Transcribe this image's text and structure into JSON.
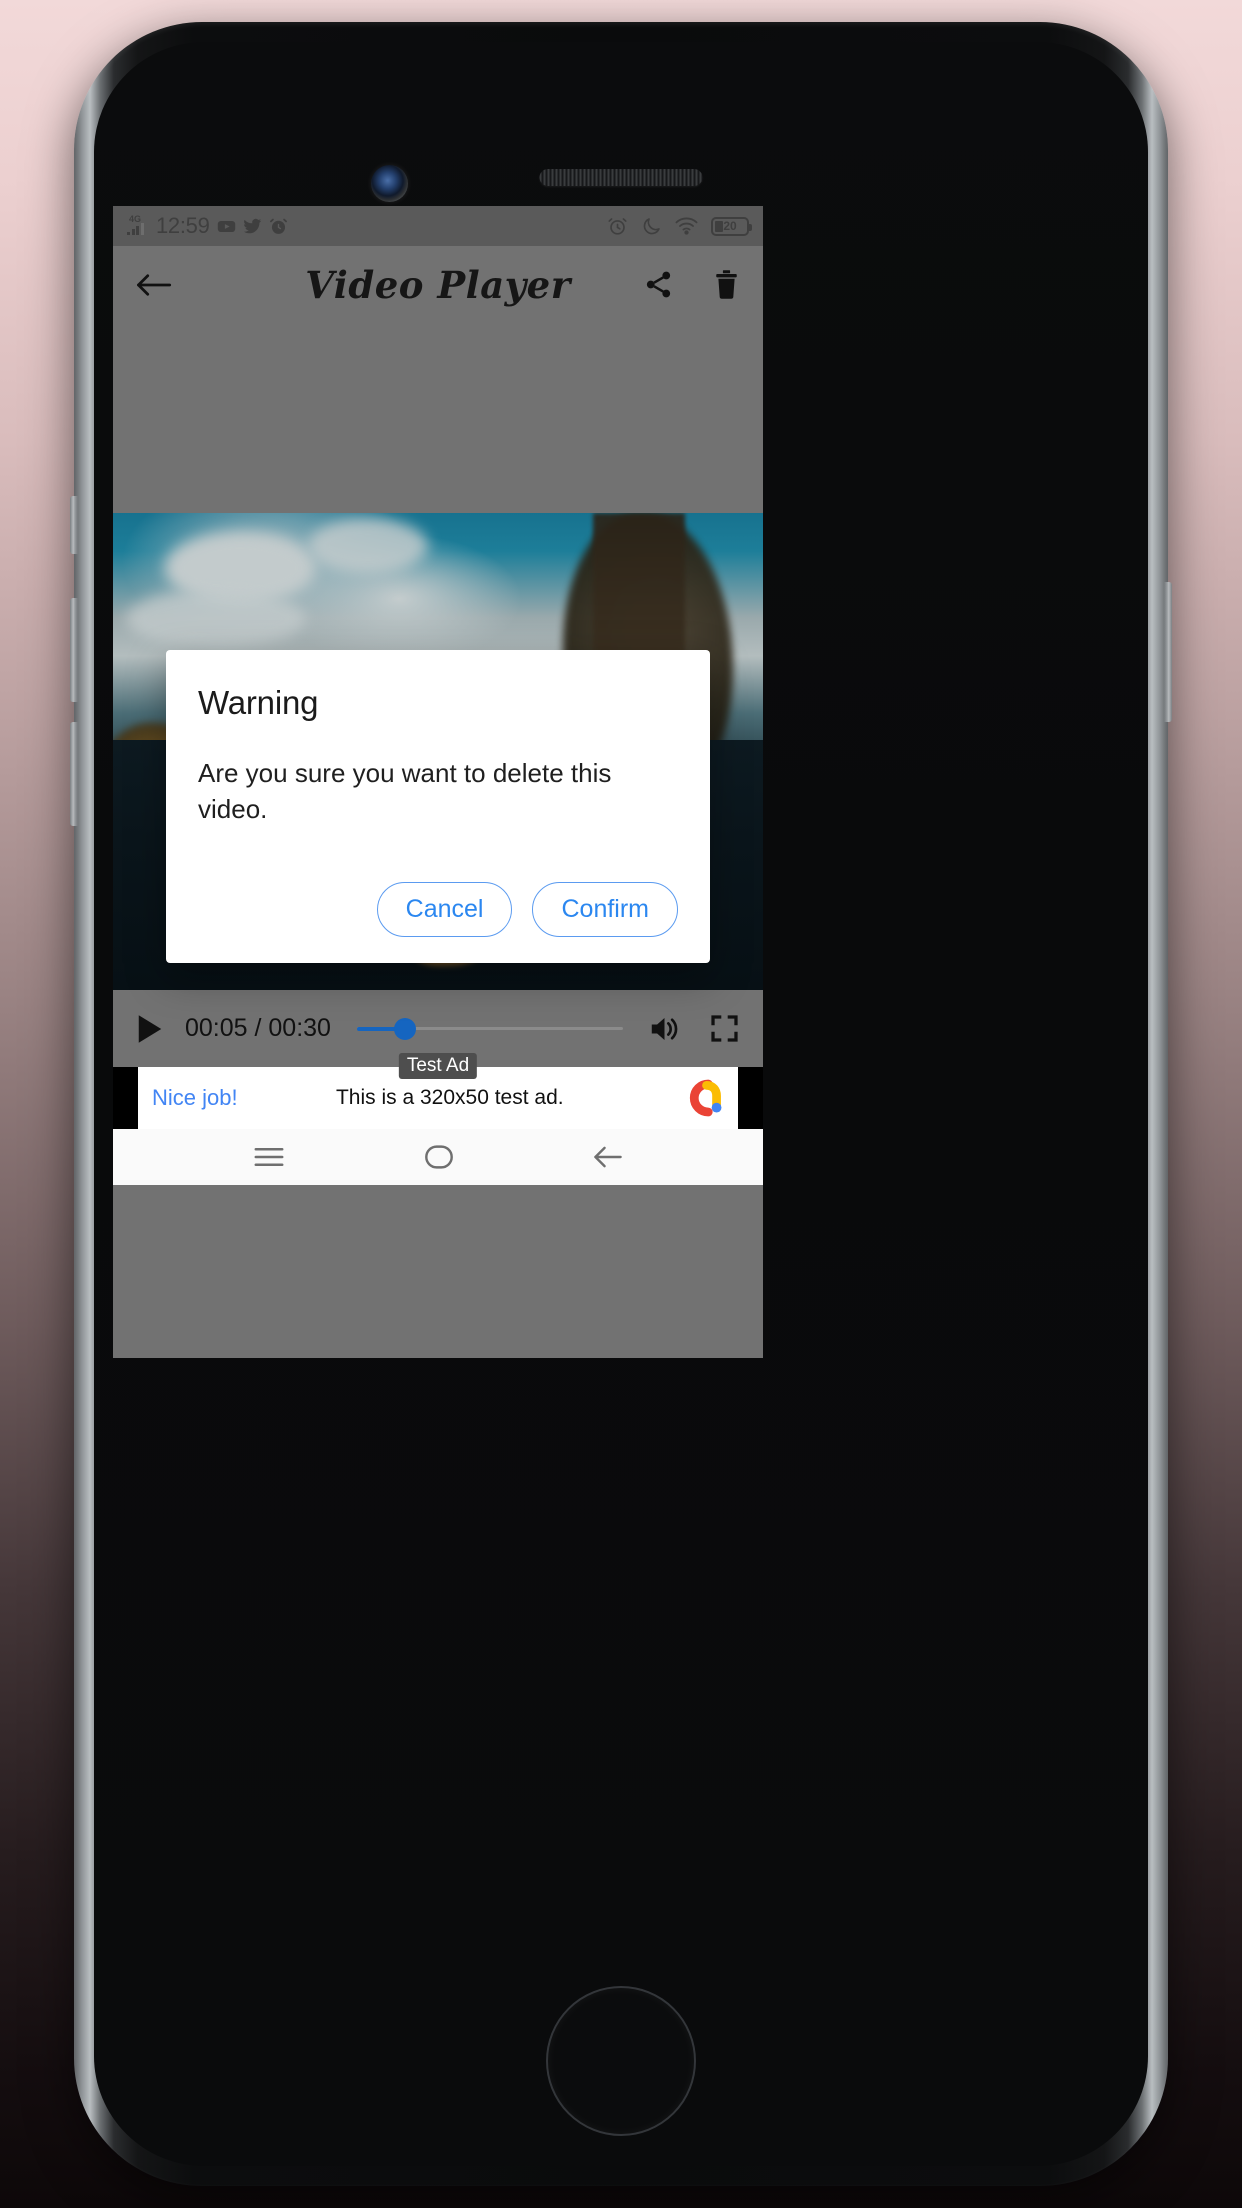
{
  "statusbar": {
    "network": "4G",
    "time": "12:59",
    "left_icons": [
      "signal-icon",
      "youtube-icon",
      "twitter-icon",
      "alarm-icon"
    ],
    "right_icons": [
      "alarm-clock-icon",
      "do-not-disturb-icon",
      "wifi-icon"
    ],
    "battery_percent": "20"
  },
  "toolbar": {
    "back_label": "back-arrow",
    "title": "Video Player",
    "share_label": "share",
    "delete_label": "delete"
  },
  "player": {
    "play_label": "play",
    "current_time": "00:05",
    "separator": "/",
    "total_time": "00:30",
    "time_display": "00:05 / 00:30",
    "progress_percent": 17,
    "volume_label": "volume",
    "fullscreen_label": "fullscreen"
  },
  "dialog": {
    "title": "Warning",
    "message": "Are you sure you want to delete this video.",
    "cancel_label": "Cancel",
    "confirm_label": "Confirm",
    "accent_color": "#2b87f0"
  },
  "ad": {
    "badge": "Test Ad",
    "cta": "Nice job!",
    "text": "This is a 320x50 test ad.",
    "logo_colors": {
      "red": "#ea4335",
      "yellow": "#fbbc04",
      "blue": "#4285f4"
    }
  },
  "navbar": {
    "recents_label": "recents",
    "home_label": "home",
    "back_label": "back"
  },
  "colors": {
    "app_background": "#727272",
    "statusbar_background": "#5a5a5a",
    "seek_accent": "#1565c0"
  }
}
